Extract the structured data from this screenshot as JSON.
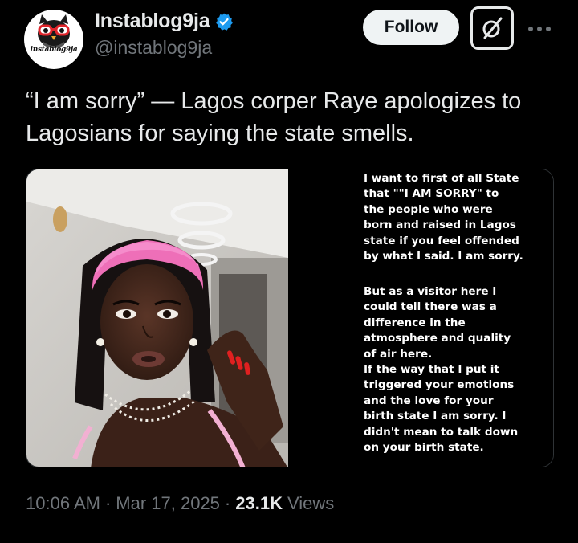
{
  "account": {
    "display_name": "Instablog9ja",
    "handle": "@instablog9ja",
    "avatar_text": "instablog9ja",
    "verified_color": "#1d9bf0"
  },
  "actions": {
    "follow_label": "Follow",
    "grok_icon": "grok-icon",
    "more_icon": "more-dots-icon"
  },
  "tweet": {
    "text": "“I am sorry” — Lagos corper Raye apologizes to Lagosians for saying the state smells."
  },
  "media": {
    "story_lines_1": [
      "I want to first of all State",
      "that \"\"I AM SORRY\" to",
      "the people who were",
      "born and raised in Lagos",
      "state if you feel offended",
      "by what I said. I am sorry."
    ],
    "story_lines_2": [
      "But as a visitor here I",
      "could tell there was a",
      "difference in the",
      "atmosphere and quality",
      "of air here.",
      "If the way that I put it",
      "triggered  your emotions",
      "and the love for your",
      "birth state I am sorry. I",
      "didn't mean to talk down",
      "on your birth state."
    ]
  },
  "meta": {
    "time": "10:06 AM",
    "date": "Mar 17, 2025",
    "views_count": "23.1K",
    "views_label": "Views",
    "separator": "·"
  }
}
